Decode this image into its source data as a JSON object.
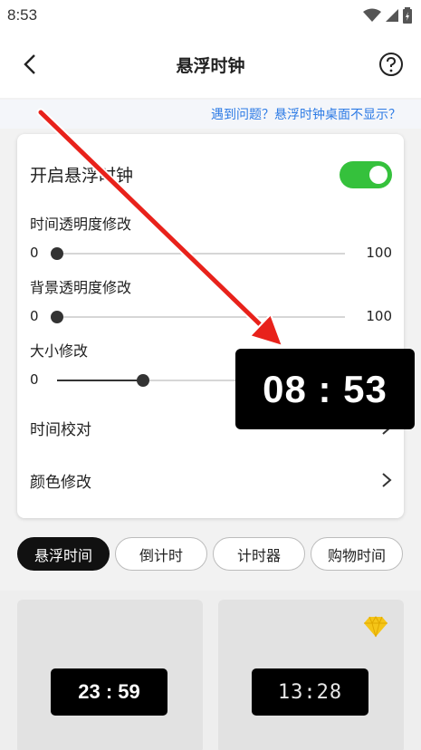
{
  "status_bar": {
    "time": "8:53"
  },
  "header": {
    "title": "悬浮时钟"
  },
  "notice": {
    "link_text": "遇到问题？悬浮时钟桌面不显示？"
  },
  "settings": {
    "enable_label": "开启悬浮时钟",
    "enabled": true,
    "time_opacity": {
      "label": "时间透明度修改",
      "min": "0",
      "max": "100",
      "value": 0
    },
    "bg_opacity": {
      "label": "背景透明度修改",
      "min": "0",
      "max": "100",
      "value": 0
    },
    "size": {
      "label": "大小修改",
      "min": "0",
      "max": "100",
      "value": 30
    },
    "time_calibration_label": "时间校对",
    "color_label": "颜色修改"
  },
  "floating_clock": {
    "time": "08 : 53"
  },
  "tabs": [
    {
      "label": "悬浮时间",
      "active": true
    },
    {
      "label": "倒计时",
      "active": false
    },
    {
      "label": "计时器",
      "active": false
    },
    {
      "label": "购物时间",
      "active": false
    }
  ],
  "styles": [
    {
      "time": "23 : 59",
      "premium": false
    },
    {
      "time": "13:28",
      "premium": true
    }
  ],
  "colors": {
    "accent_green": "#35c13c",
    "link_blue": "#2d7be5",
    "arrow_red": "#e8221b",
    "gem_yellow": "#f5c518"
  }
}
